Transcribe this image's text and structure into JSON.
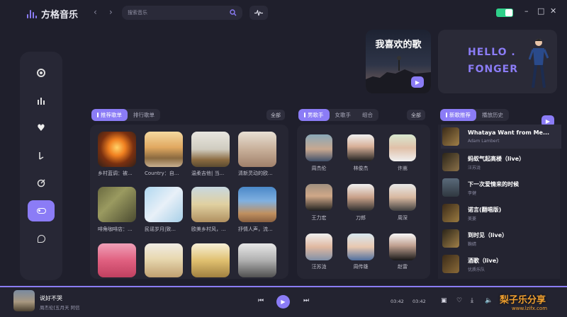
{
  "app": {
    "title": "方格音乐"
  },
  "search": {
    "placeholder": "搜索音乐"
  },
  "banner": {
    "favorite_title": "我喜欢的歌",
    "hello_line1": "HELLO .",
    "hello_line2": "FONGER"
  },
  "playlists": {
    "tabs": [
      "推荐歌单",
      "排行歌单"
    ],
    "all_label": "全部",
    "items": [
      {
        "label": "乡村蓝调：被..."
      },
      {
        "label": "Country：自..."
      },
      {
        "label": "温柔吉他| 当..."
      },
      {
        "label": "清新灵动的欧..."
      },
      {
        "label": "啡角咖啡店：..."
      },
      {
        "label": "民谣岁月|致..."
      },
      {
        "label": "欧美乡村风，..."
      },
      {
        "label": "抒情人声，流..."
      },
      {
        "label": ""
      },
      {
        "label": ""
      },
      {
        "label": ""
      },
      {
        "label": ""
      }
    ]
  },
  "singers": {
    "tabs": [
      "男歌手",
      "女歌手",
      "组合"
    ],
    "all_label": "全部",
    "items": [
      {
        "name": "周杰伦"
      },
      {
        "name": "林俊杰"
      },
      {
        "name": "许嵩"
      },
      {
        "name": "王力宏"
      },
      {
        "name": "刀郎"
      },
      {
        "name": "周深"
      },
      {
        "name": "汪苏泷"
      },
      {
        "name": "周传雄"
      },
      {
        "name": "赵雷"
      }
    ]
  },
  "songs": {
    "tabs": [
      "新歌推荐",
      "播放历史"
    ],
    "items": [
      {
        "name": "Whataya Want from Me...",
        "artist": "Adam Lambert"
      },
      {
        "name": "蚂蚁气起高楼（live）",
        "artist": "汪苏泷"
      },
      {
        "name": "下一次爱情来的时候",
        "artist": "李健"
      },
      {
        "name": "诺言(翻唱版)",
        "artist": "美菱"
      },
      {
        "name": "到时见（live）",
        "artist": "鞠婧"
      },
      {
        "name": "酒歌（live）",
        "artist": "优质乐队"
      }
    ]
  },
  "player": {
    "song": "说好不哭",
    "artist": "周杰伦[五月天 阿信",
    "current_time": "03:42",
    "total_time": "03:42"
  },
  "watermark": {
    "main": "梨子乐分享",
    "sub": "www.lzifx.com"
  },
  "colors": {
    "accent": "#8b7cf6",
    "background": "#1f1f2c",
    "toggle": "#2fd08a"
  }
}
